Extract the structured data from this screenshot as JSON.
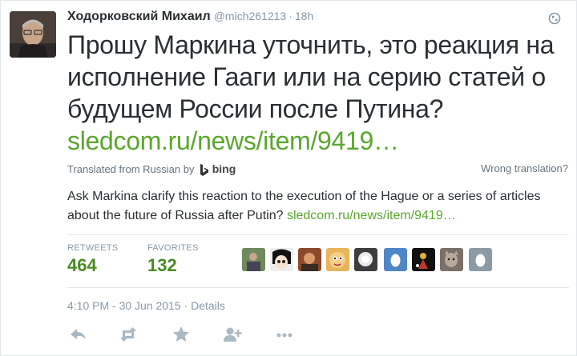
{
  "tweet": {
    "author_name": "Ходорковский Михаил",
    "username": "@mich261213",
    "separator": "·",
    "time_ago": "18h",
    "text_lines": [
      "Прошу Маркина уточнить, это реакция на",
      "исполнение Гааги или на серию статей о",
      "будущем России после Путина?"
    ],
    "link": "sledcom.ru/news/item/9419…"
  },
  "translation": {
    "translated_from": "Translated from Russian by",
    "provider": "bing",
    "wrong": "Wrong translation?",
    "text": "Ask Markina clarify this reaction to the execution of the Hague or a series of articles about the future of Russia after Putin?",
    "link": "sledcom.ru/news/item/9419…"
  },
  "stats": {
    "retweets_label": "RETWEETS",
    "retweets_value": "464",
    "favorites_label": "FAVORITES",
    "favorites_value": "132"
  },
  "meta": {
    "timestamp": "4:10 PM - 30 Jun 2015",
    "separator": "·",
    "details": "Details"
  },
  "icons": {
    "globe": "globe-icon",
    "reply": "reply-icon",
    "retweet": "retweet-icon",
    "favorite": "star-icon",
    "follow": "follow-icon",
    "more": "more-icon"
  },
  "colors": {
    "link": "#5aa72d",
    "stat_value": "#4a8b22",
    "muted": "#8899a6",
    "text": "#292f33"
  }
}
